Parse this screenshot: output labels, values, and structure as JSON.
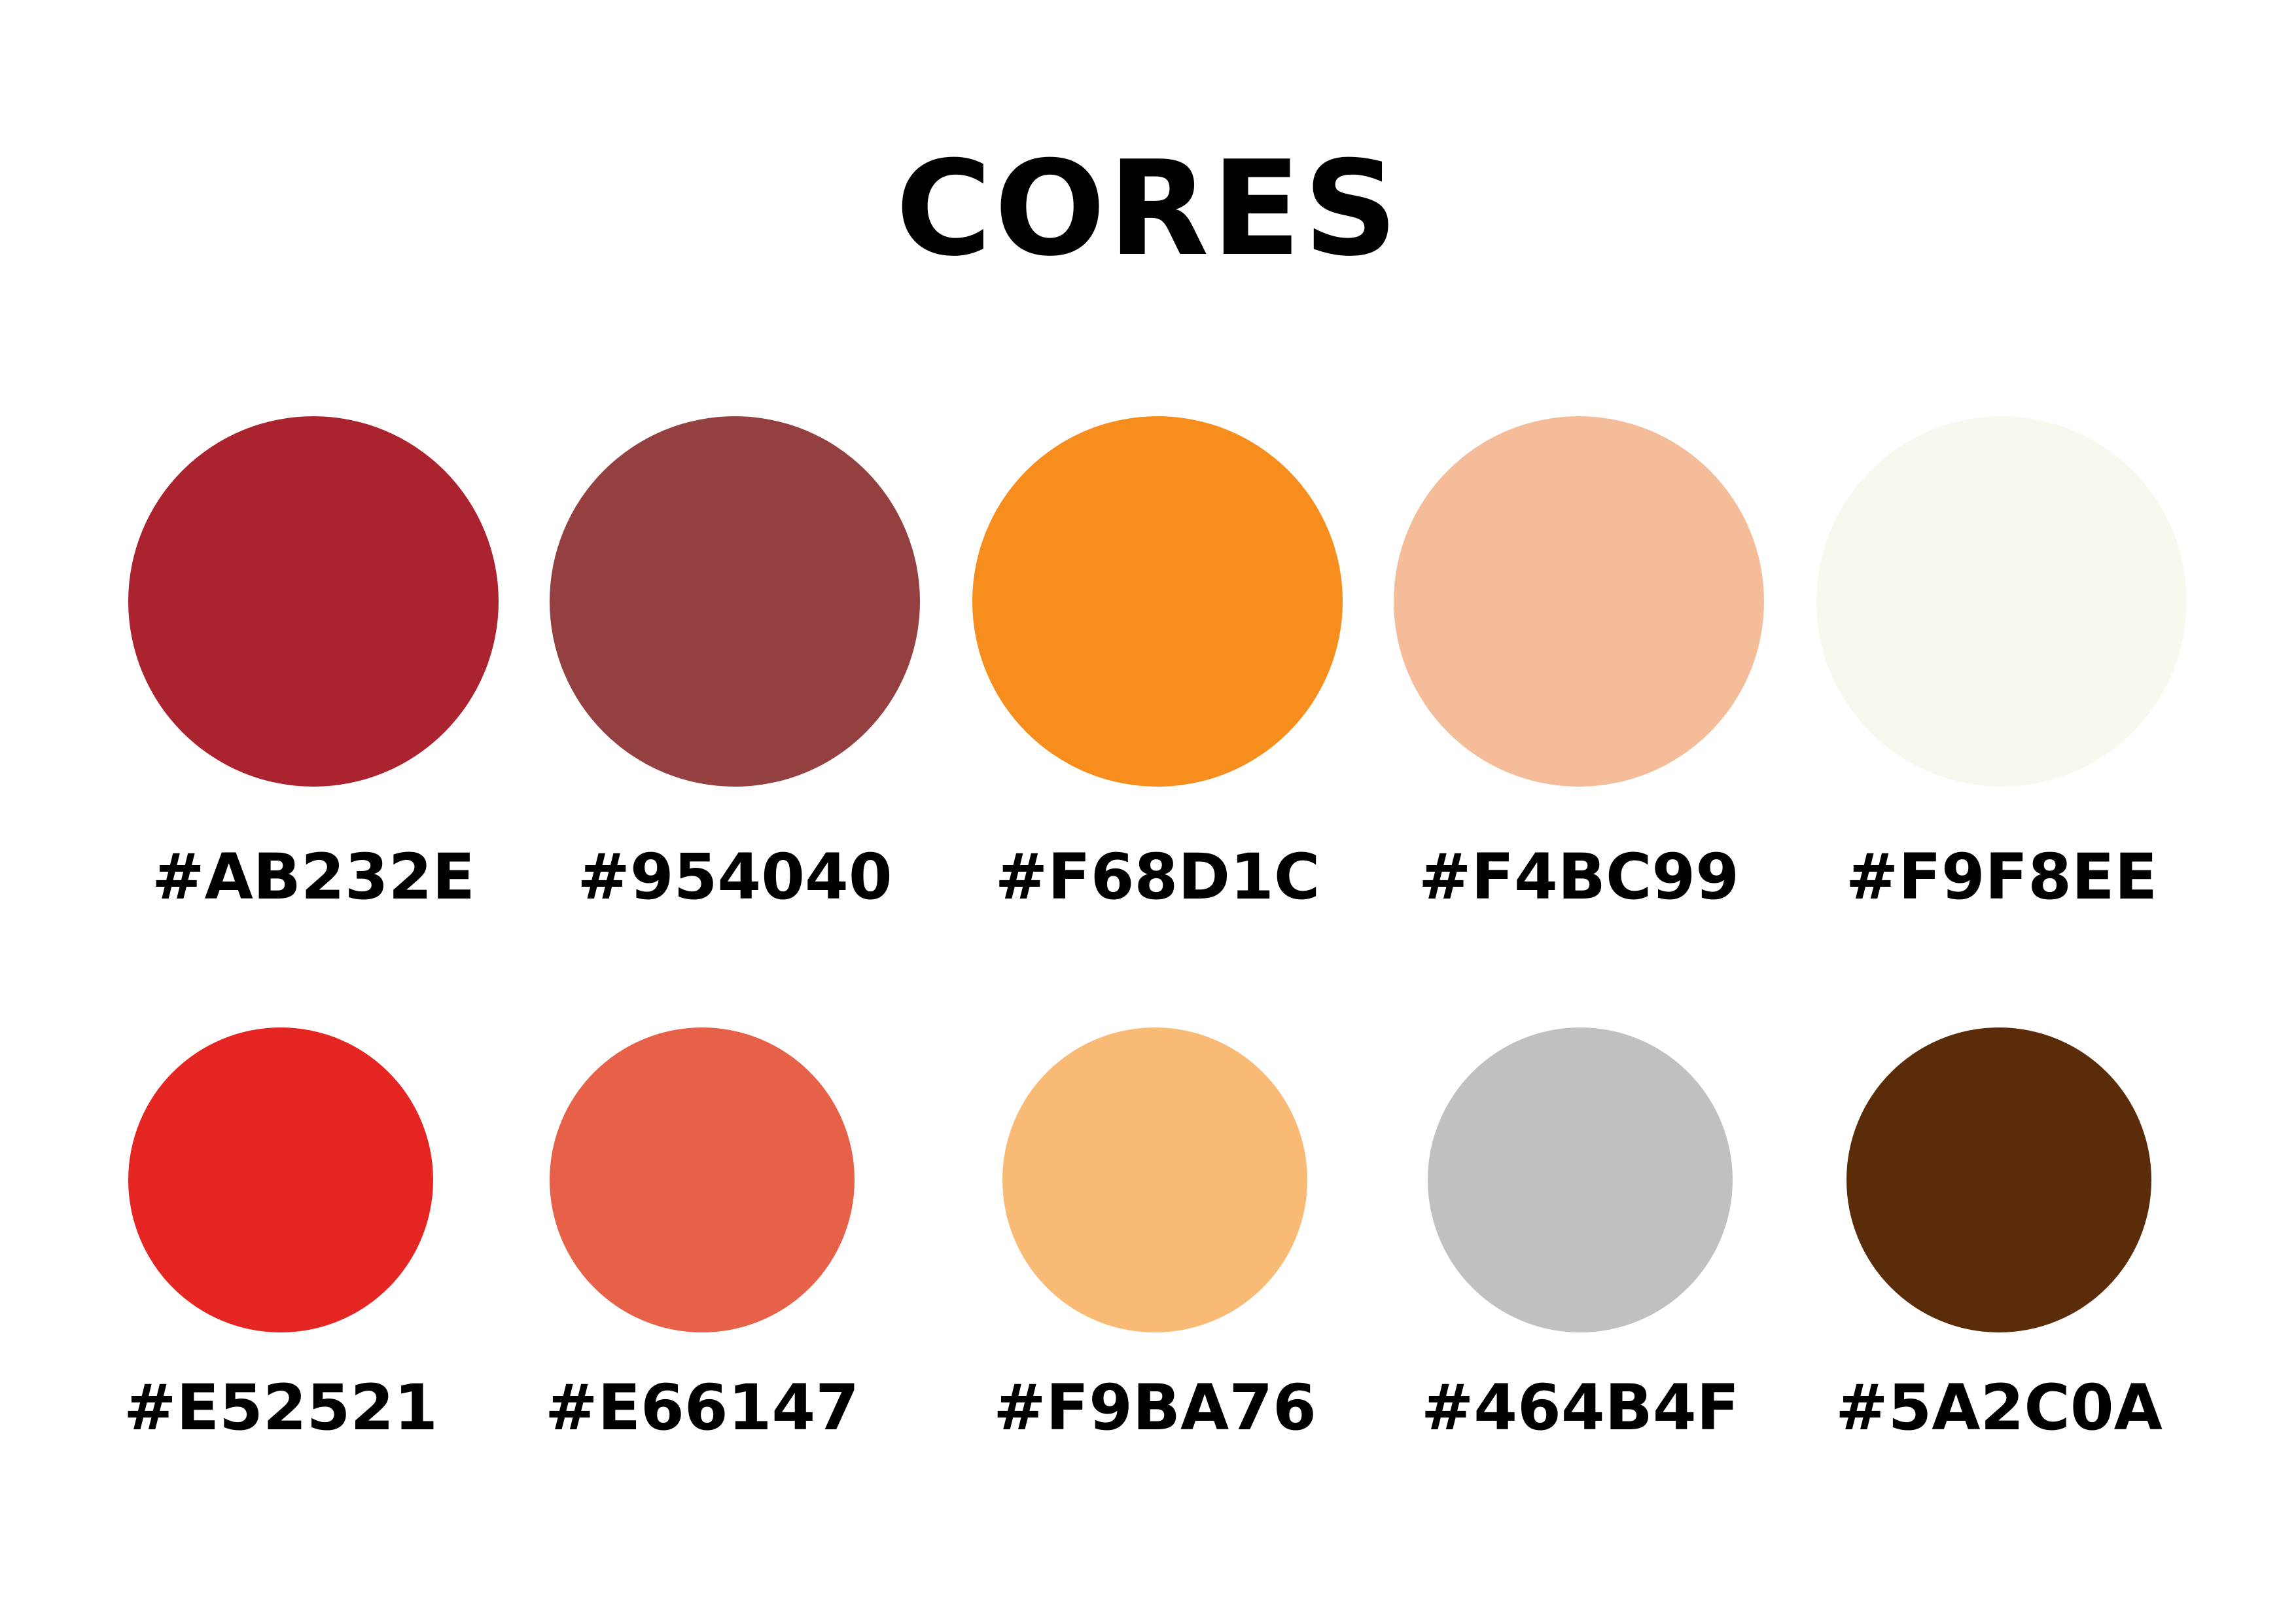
{
  "title": "CORES",
  "swatches": [
    {
      "label": "#AB232E",
      "color": "#AB232E"
    },
    {
      "label": "#954040",
      "color": "#954040"
    },
    {
      "label": "#F68D1C",
      "color": "#F68D1C"
    },
    {
      "label": "#F4BC99",
      "color": "#F4BC99"
    },
    {
      "label": "#F9F8EE",
      "color": "#F9F8EE"
    },
    {
      "label": "#E52521",
      "color": "#E52521"
    },
    {
      "label": "#E66147",
      "color": "#E66147"
    },
    {
      "label": "#F9BA76",
      "color": "#F9BA76"
    },
    {
      "label": "#464B4F",
      "color": "#C0C0C0"
    },
    {
      "label": "#5A2C0A",
      "color": "#5A2C0A"
    }
  ]
}
